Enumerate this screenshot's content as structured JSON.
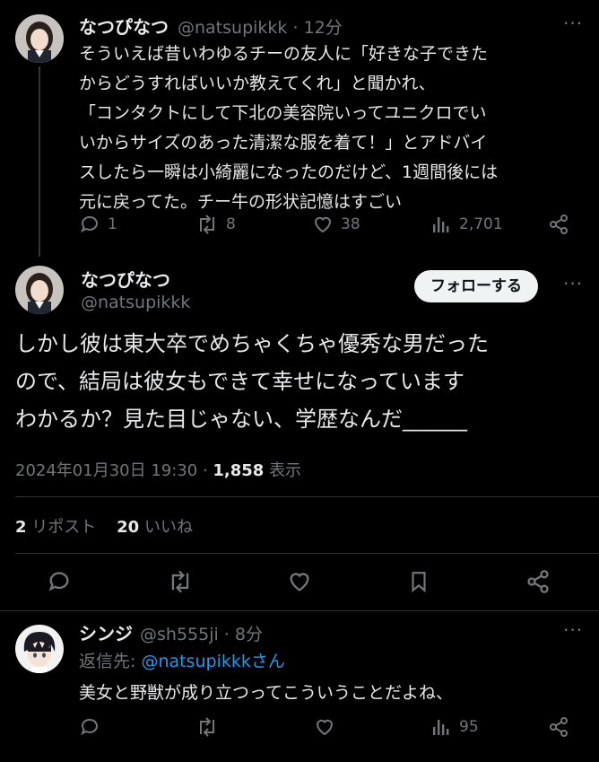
{
  "tweet1": {
    "name": "なつぴなつ",
    "handle": "@natsupikkk",
    "time": "12分",
    "text": "そういえば昔いわゆるチーの友人に「好きな子できた\nからどうすればいいか教えてくれ」と聞かれ、\n「コンタクトにして下北の美容院いってユニクロでい\nいからサイズのあった清潔な服を着て！」とアドバイ\nスしたら一瞬は小綺麗になったのだけど、1週間後には\n元に戻ってた。チー牛の形状記憶はすごい",
    "replies": "1",
    "reposts": "8",
    "likes": "38",
    "views": "2,701"
  },
  "tweet2": {
    "name": "なつぴなつ",
    "handle": "@natsupikkk",
    "follow_label": "フォローする",
    "text": "しかし彼は東大卒でめちゃくちゃ優秀な男だった\nので、結局は彼女もできて幸せになっています\nわかるか？見た目じゃない、学歴なんだ______",
    "date": "2024年01月30日 19:30",
    "views": "1,858",
    "views_label": "表示",
    "reposts": "2",
    "reposts_label": "リポスト",
    "likes": "20",
    "likes_label": "いいね"
  },
  "reply": {
    "name": "シンジ",
    "handle": "@sh555ji",
    "time": "8分",
    "reply_to_prefix": "返信先:",
    "reply_to_user": "@natsupikkkさん",
    "text": "美女と野獣が成り立つってこういうことだよね、",
    "views": "95"
  },
  "colors": {
    "accent": "#1d9bf0",
    "muted": "#71767b",
    "text": "#e7e9ea",
    "background": "#000000"
  }
}
